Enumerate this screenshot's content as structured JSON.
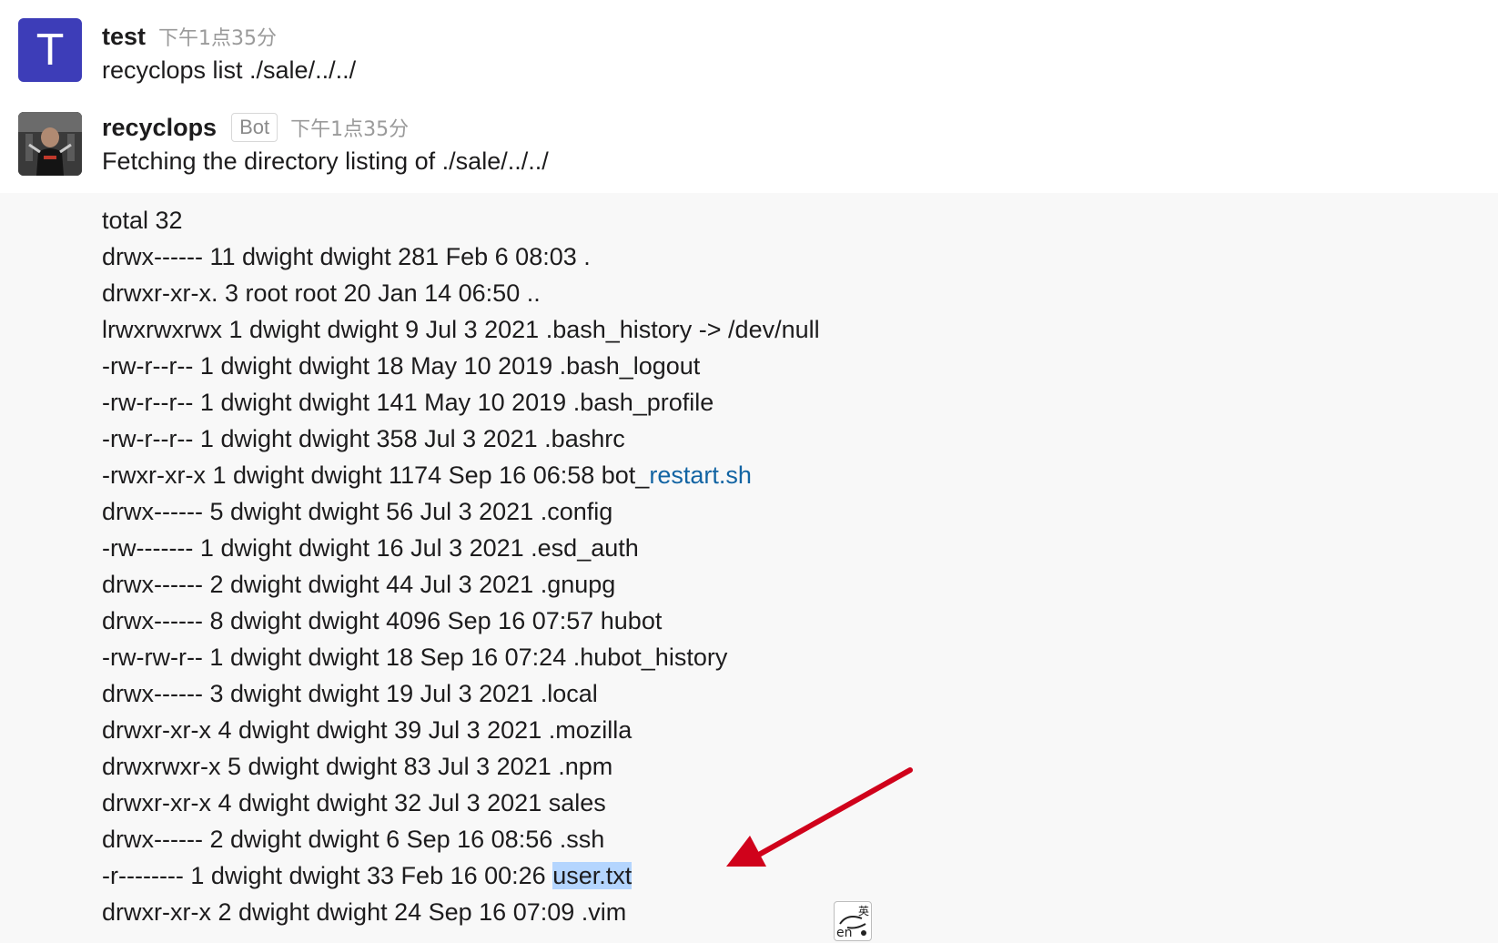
{
  "messages": [
    {
      "avatar_letter": "T",
      "username": "test",
      "timestamp": "下午1点35分",
      "text": "recyclops list ./sale/../../"
    },
    {
      "username": "recyclops",
      "badge": "Bot",
      "timestamp": "下午1点35分",
      "text": "Fetching the directory listing of ./sale/../../"
    }
  ],
  "listing": {
    "lines": [
      "total 32",
      "drwx------ 11 dwight dwight 281 Feb 6 08:03 .",
      "drwxr-xr-x. 3 root root 20 Jan 14 06:50 ..",
      "lrwxrwxrwx 1 dwight dwight 9 Jul 3 2021 .bash_history -> /dev/null",
      "-rw-r--r-- 1 dwight dwight 18 May 10 2019 .bash_logout",
      "-rw-r--r-- 1 dwight dwight 141 May 10 2019 .bash_profile",
      "-rw-r--r-- 1 dwight dwight 358 Jul 3 2021 .bashrc",
      "-rwxr-xr-x 1 dwight dwight 1174 Sep 16 06:58 bot_",
      "drwx------ 5 dwight dwight 56 Jul 3 2021 .config",
      "-rw------- 1 dwight dwight 16 Jul 3 2021 .esd_auth",
      "drwx------ 2 dwight dwight 44 Jul 3 2021 .gnupg",
      "drwx------ 8 dwight dwight 4096 Sep 16 07:57 hubot",
      "-rw-rw-r-- 1 dwight dwight 18 Sep 16 07:24 .hubot_history",
      "drwx------ 3 dwight dwight 19 Jul 3 2021 .local",
      "drwxr-xr-x 4 dwight dwight 39 Jul 3 2021 .mozilla",
      "drwxrwxr-x 5 dwight dwight 83 Jul 3 2021 .npm",
      "drwxr-xr-x 4 dwight dwight 32 Jul 3 2021 sales",
      "drwx------ 2 dwight dwight 6 Sep 16 08:56 .ssh",
      "-r-------- 1 dwight dwight 33 Feb 16 00:26 ",
      "drwxr-xr-x 2 dwight dwight 24 Sep 16 07:09 .vim"
    ],
    "link_text": "restart.sh",
    "selected_text": "user.txt"
  },
  "ime_indicator": {
    "top": "英",
    "bottom": "en"
  },
  "colors": {
    "link": "#1264a3",
    "selection": "#b4d5fe",
    "arrow": "#d0021b",
    "avatar_bg": "#3d3db8"
  }
}
